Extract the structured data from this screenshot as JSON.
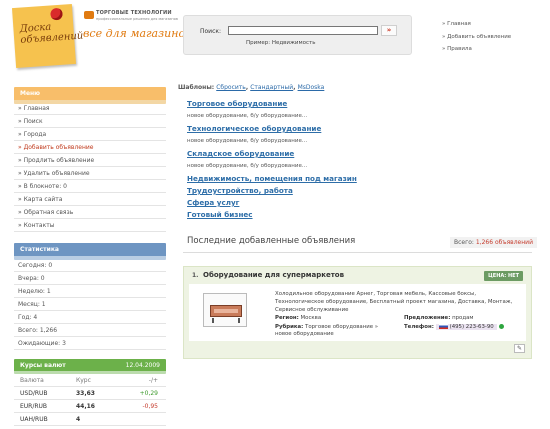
{
  "header": {
    "logo_text": "Доска объявлений",
    "brand_name": "ТОРГОВЫЕ ТЕХНОЛОГИИ",
    "brand_sub": "профессиональные решения для магазинов",
    "slogan": "все для магазинов"
  },
  "search": {
    "label": "Поиск:",
    "value": "",
    "button": "»",
    "example": "Пример: Недвижимость"
  },
  "top_links": [
    "» Главная",
    "» Добавить объявление",
    "» Правила"
  ],
  "menu": {
    "title": "Меню",
    "items": [
      {
        "label": "» Главная"
      },
      {
        "label": "» Поиск"
      },
      {
        "label": "» Города"
      },
      {
        "label": "» Добавить объявление",
        "active": true
      },
      {
        "label": "» Продлить объявление"
      },
      {
        "label": "» Удалить объявление"
      },
      {
        "label": "» В блокноте:    0"
      },
      {
        "label": "» Карта сайта"
      },
      {
        "label": "» Обратная связь"
      },
      {
        "label": "» Контакты"
      }
    ]
  },
  "stats": {
    "title": "Статистика",
    "items": [
      "Сегодня: 0",
      "Вчера: 0",
      "Неделю: 1",
      "Месяц: 1",
      "Год: 4",
      "Всего: 1,266",
      "Ожидающие: 3"
    ]
  },
  "currency": {
    "title": "Курсы валют",
    "date": "12.04.2009",
    "headers": [
      "Валюта",
      "Курс",
      "-/+"
    ],
    "rows": [
      {
        "pair": "USD/RUB",
        "rate": "33,63",
        "change": "+0,29",
        "dir": "up"
      },
      {
        "pair": "EUR/RUB",
        "rate": "44,16",
        "change": "-0,95",
        "dir": "down"
      },
      {
        "pair": "UAH/RUB",
        "rate": "4",
        "change": "",
        "dir": ""
      }
    ]
  },
  "templates": {
    "label": "Шаблоны:",
    "links": [
      "Сбросить",
      "Стандартный",
      "MsDoska"
    ]
  },
  "categories": [
    {
      "title": "Торговое оборудование",
      "desc": "новое оборудование, б/у оборудование..."
    },
    {
      "title": "Технологическое оборудование",
      "desc": "новое оборудование, б/у оборудование..."
    },
    {
      "title": "Складское оборудование",
      "desc": "новое оборудование, б/у оборудование..."
    },
    {
      "title": "Недвижимость, помещения под магазин",
      "desc": ""
    },
    {
      "title": "Трудоустройство, работа",
      "desc": ""
    },
    {
      "title": "Сфера услуг",
      "desc": ""
    },
    {
      "title": "Готовый бизнес",
      "desc": ""
    }
  ],
  "recent": {
    "title": "Последние добавленные объявления",
    "count_label": "Всего:",
    "count_value": "1,266 объявлений"
  },
  "ad": {
    "num": "1.",
    "title": "Оборудование для супермаркетов",
    "price": "ЦЕНА: НЕТ",
    "description": "Холодильное оборудование Арнег, Торговая мебель, Кассовые боксы, Технологическое оборудование, Бесплатный проект магазина, Доставка, Монтаж, Сервисное обслуживание",
    "region_label": "Регион:",
    "region": "Москва",
    "rubric_label": "Рубрика:",
    "rubric": "Торговое оборудование » новое оборудование",
    "offer_label": "Предложение:",
    "offer": "продам",
    "phone_label": "Телефон:",
    "phone": "(495) 223-63-90"
  },
  "colors": {
    "menu_head": "#f8be6a",
    "stat_head": "#6e95c2",
    "currency_head": "#6cb14a",
    "link": "#2e6ea8",
    "accent": "#e07a10"
  }
}
